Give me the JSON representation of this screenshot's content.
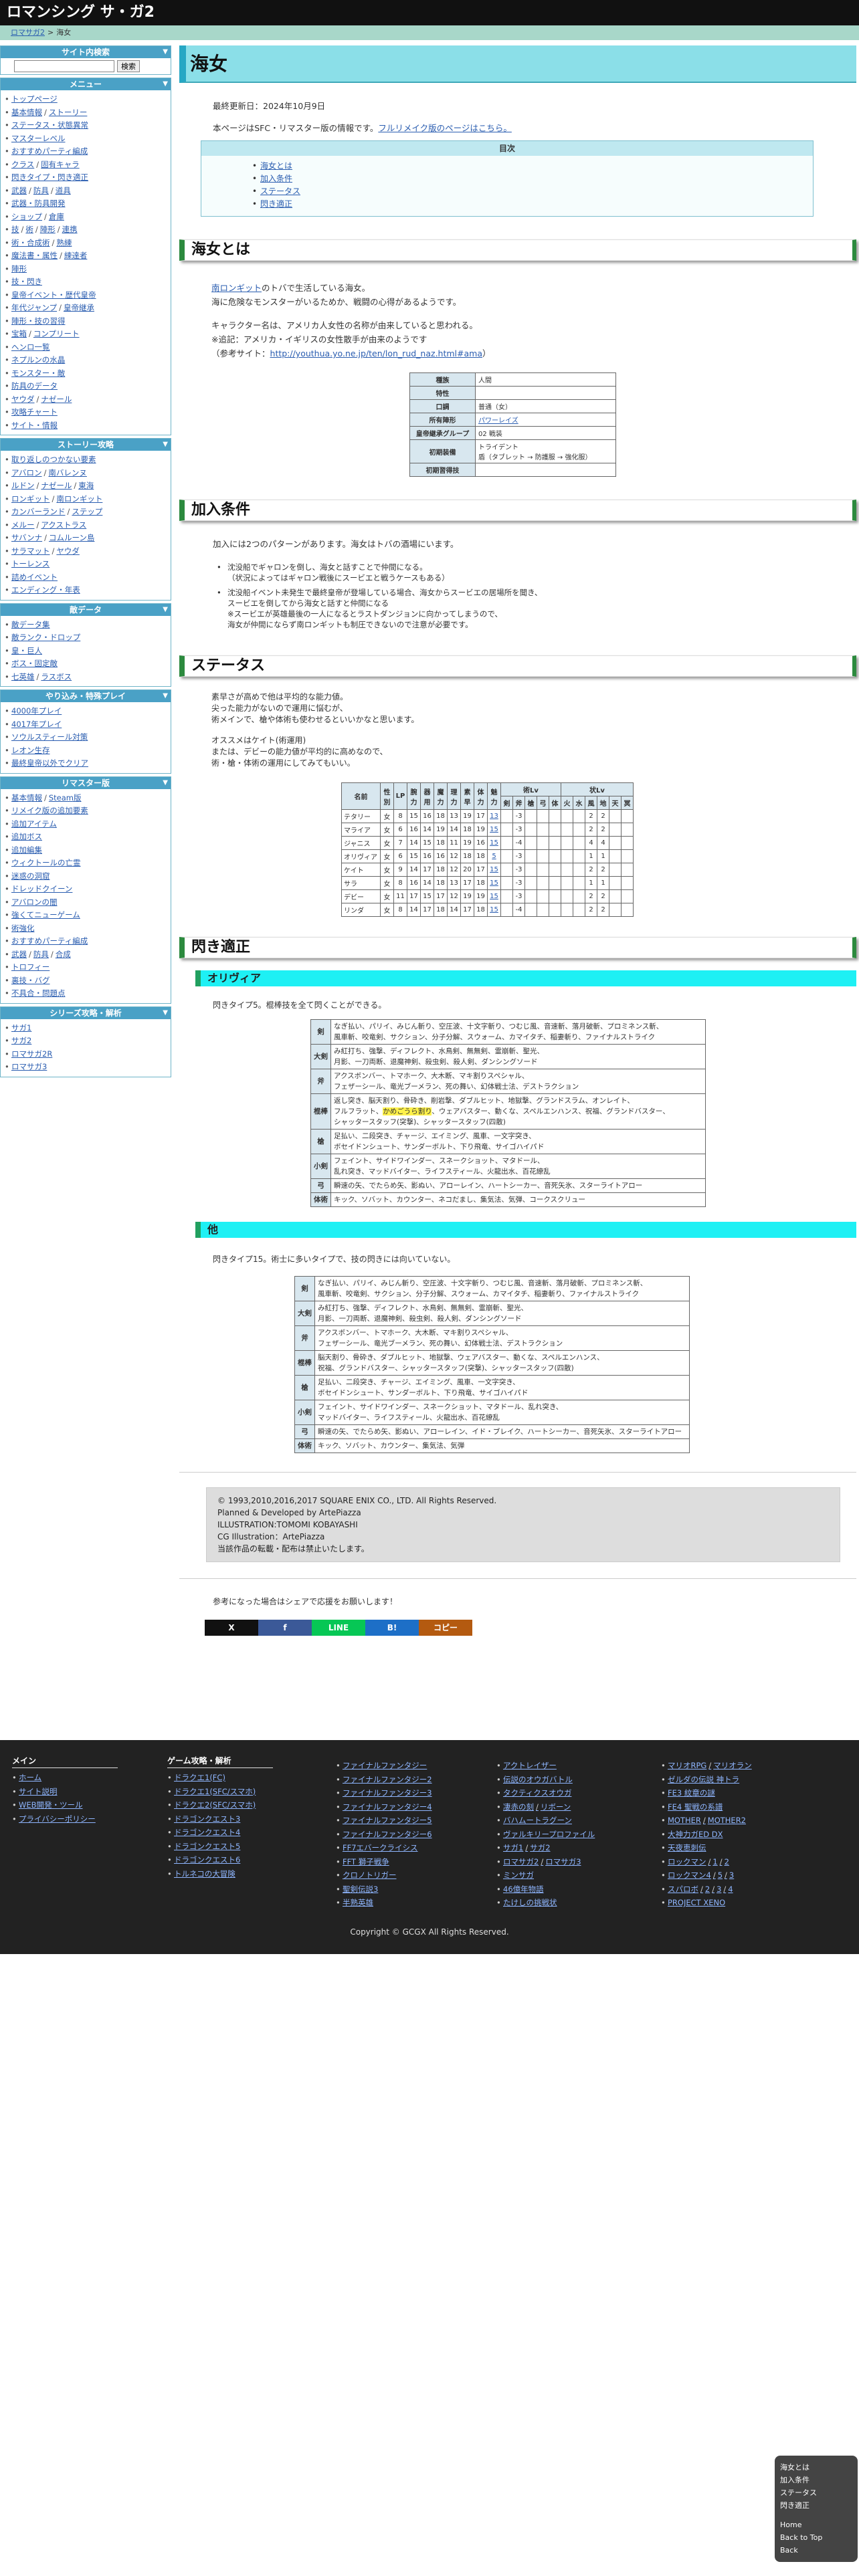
{
  "site_title": "ロマンシング サ・ガ2",
  "breadcrumb": {
    "home": "ロマサガ2",
    "sep": ">",
    "current": "海女"
  },
  "sidebar": {
    "search": {
      "title": "サイト内検索",
      "button": "検索"
    },
    "menu": {
      "title": "メニュー",
      "items": [
        [
          "トップページ"
        ],
        [
          "基本情報",
          "ストーリー"
        ],
        [
          "ステータス・状態異常"
        ],
        [
          "マスターレベル"
        ],
        [
          "おすすめパーティ編成"
        ],
        [
          "クラス",
          "固有キャラ"
        ],
        [
          "閃きタイプ・閃き適正"
        ],
        [
          "武器",
          "防具",
          "道具"
        ],
        [
          "武器・防具開発"
        ],
        [
          "ショップ",
          "倉庫"
        ],
        [
          "技",
          "術",
          "陣形",
          "連携"
        ],
        [
          "術・合成術",
          "熟練"
        ],
        [
          "魔法書・属性",
          "練達者"
        ],
        [
          "陣形"
        ],
        [
          "技・閃き"
        ],
        [
          "皇帝イベント・歴代皇帝"
        ],
        [
          "年代ジャンプ",
          "皇帝継承"
        ],
        [
          "陣形・技の習得"
        ],
        [
          "宝箱",
          "コンプリート"
        ],
        [
          "ヘンロ一覧"
        ],
        [
          "ネプルンの水晶"
        ],
        [
          "モンスター・敵"
        ],
        [
          "防具のデータ"
        ],
        [
          "ヤウダ",
          "ナゼール"
        ],
        [
          "攻略チャート"
        ],
        [
          "サイト・情報"
        ]
      ]
    },
    "story": {
      "title": "ストーリー攻略",
      "items": [
        [
          "取り返しのつかない要素"
        ],
        [
          "アバロン",
          "南バレンヌ"
        ],
        [
          "ルドン",
          "ナゼール",
          "東海"
        ],
        [
          "ロンギット",
          "南ロンギット"
        ],
        [
          "カンバーランド",
          "ステップ"
        ],
        [
          "メルー",
          "アクストラス"
        ],
        [
          "サバンナ",
          "コムルーン島"
        ],
        [
          "サラマット",
          "ヤウダ"
        ],
        [
          "トーレンス"
        ],
        [
          "詰めイベント"
        ],
        [
          "エンディング・年表"
        ]
      ]
    },
    "db": {
      "title": "敵データ",
      "items": [
        [
          "敵データ集"
        ],
        [
          "敵ランク・ドロップ"
        ],
        [
          "皇・巨人"
        ],
        [
          "ボス・固定敵"
        ],
        [
          "七英雄",
          "ラスボス"
        ]
      ]
    },
    "play": {
      "title": "やり込み・特殊プレイ",
      "items": [
        [
          "4000年プレイ"
        ],
        [
          "4017年プレイ"
        ],
        [
          "ソウルスティール対策"
        ],
        [
          "レオン生存"
        ],
        [
          "最終皇帝以外でクリア"
        ]
      ]
    },
    "remaster": {
      "title": "リマスター版",
      "items": [
        [
          "基本情報",
          "Steam版"
        ],
        [
          "リメイク版の追加要素"
        ],
        [
          "追加アイテム"
        ],
        [
          "追加ボス"
        ],
        [
          "追加編集"
        ],
        [
          "ウィクトールの亡霊"
        ],
        [
          "迷惑の洞窟"
        ],
        [
          "ドレッドクイーン"
        ],
        [
          "アバロンの闇"
        ],
        [
          "強くてニューゲーム"
        ],
        [
          "術強化"
        ],
        [
          "おすすめパーティ編成"
        ],
        [
          "武器",
          "防具",
          "合成"
        ],
        [
          "トロフィー"
        ],
        [
          "裏技・バグ"
        ],
        [
          "不具合・問題点"
        ]
      ]
    },
    "series": {
      "title": "シリーズ攻略・解析",
      "items": [
        [
          "サガ1"
        ],
        [
          "サガ2"
        ],
        [
          "ロマサガ2R"
        ],
        [
          "ロマサガ3"
        ]
      ]
    }
  },
  "page": {
    "title": "海女",
    "updated": "最終更新日：2024年10月9日",
    "intro_text": "本ページはSFC・リマスター版の情報です。",
    "intro_link": "フルリメイク版のページはこちら。",
    "toc": {
      "title": "目次",
      "items": [
        "海女とは",
        "加入条件",
        "ステータス",
        "閃き適正"
      ]
    },
    "s1": {
      "heading": "海女とは",
      "l1_link": "南ロンギット",
      "l1": "のトバで生活している海女。",
      "l2": "海に危険なモンスターがいるためか、戦闘の心得があるようです。",
      "l3": "キャラクター名は、アメリカ人女性の名称が由来していると思われる。",
      "l4": "※追記：アメリカ・イギリスの女性散手が由来のようです",
      "l5": "（参考サイト：",
      "l5_link": "http://youthua.yo.ne.jp/ten/lon_rud_naz.html#ama",
      "l5_end": "）",
      "attr": [
        [
          "種族",
          "人間"
        ],
        [
          "特性",
          ""
        ],
        [
          "口調",
          "普通（女）"
        ],
        [
          "所有陣形",
          "パワーレイズ"
        ],
        [
          "皇帝継承グループ",
          "02 戦装"
        ],
        [
          "初期装備",
          "トライデント\n盾（タブレット → 防護服 → 強化服）"
        ],
        [
          "初期習得技",
          ""
        ]
      ]
    },
    "s2": {
      "heading": "加入条件",
      "l1": "加入には2つのパターンがあります。海女はトバの酒場にいます。",
      "b1a": "沈没船でギャロンを倒し、海女と話すことで仲間になる。",
      "b1b": "（状況によってはギャロン戦後にスービエと戦うケースもある）",
      "b2a": "沈没船イベント未発生で最終皇帝が登場している場合、海女からスービエの居場所を聞き、",
      "b2b": "スービエを倒してから海女と話すと仲間になる",
      "b2c": "※スービエが英雄最後の一人になるとラストダンジョンに向かってしまうので、",
      "b2d": "海女が仲間にならず南ロンギットも制圧できないので注意が必要です。"
    },
    "s3": {
      "heading": "ステータス",
      "l1": "素早さが高めで他は平均的な能力値。",
      "l2": "尖った能力がないので運用に悩むが、",
      "l3": "術メインで、槍や体術も使わせるといいかなと思います。",
      "l4": "オススメはケイト(術運用)",
      "l5": "または、デビーの能力値が平均的に高めなので、",
      "l6": "術・槍・体術の運用にしてみてもいい。",
      "head1": [
        "名前",
        "性別",
        "LP",
        "腕力",
        "器用",
        "魔力",
        "理力",
        "素早",
        "体力",
        "魅力",
        "術Lv",
        "状Lv"
      ],
      "jlv": [
        "剣",
        "斧",
        "槍",
        "弓",
        "体"
      ],
      "slv": [
        "火",
        "水",
        "風",
        "地",
        "天",
        "冥"
      ],
      "rows": [
        [
          "テタリー",
          "女",
          "8",
          "15",
          "16",
          "18",
          "13",
          "19",
          "17",
          "13",
          "-3",
          "",
          "2",
          "2"
        ],
        [
          "マライア",
          "女",
          "6",
          "16",
          "14",
          "19",
          "14",
          "18",
          "19",
          "15",
          "-3",
          "",
          "2",
          "2"
        ],
        [
          "ジャニス",
          "女",
          "7",
          "14",
          "15",
          "18",
          "11",
          "19",
          "16",
          "15",
          "-4",
          "",
          "4",
          "4"
        ],
        [
          "オリヴィア",
          "女",
          "6",
          "15",
          "16",
          "16",
          "12",
          "18",
          "18",
          "5",
          "-3",
          "",
          "1",
          "1"
        ],
        [
          "ケイト",
          "女",
          "9",
          "14",
          "17",
          "18",
          "12",
          "20",
          "17",
          "15",
          "-3",
          "",
          "2",
          "2"
        ],
        [
          "サラ",
          "女",
          "8",
          "16",
          "14",
          "18",
          "13",
          "17",
          "18",
          "15",
          "-3",
          "",
          "1",
          "1"
        ],
        [
          "デビー",
          "女",
          "11",
          "17",
          "15",
          "17",
          "12",
          "19",
          "19",
          "15",
          "-3",
          "",
          "2",
          "2"
        ],
        [
          "リンダ",
          "女",
          "8",
          "14",
          "17",
          "18",
          "14",
          "17",
          "18",
          "15",
          "-4",
          "",
          "2",
          "2"
        ]
      ]
    },
    "s4": {
      "heading": "閃き適正",
      "sub1": "オリヴィア",
      "sub1_text": "閃きタイプ5。棍棒技を全て閃くことができる。",
      "t1": [
        [
          "剣",
          "なぎ払い、パリイ、みじん斬り、空圧波、十文字斬り、つむじ風、音速斬、落月破斬、プロミネンス斬、\n風車斬、咬竜剣、サクション、分子分解、スウォーム、カマイタチ、稲妻斬り、ファイナルストライク",
          ""
        ],
        [
          "大剣",
          "み紅打ち、強撃、ディフレクト、水鳥剣、無無剣、霊崩斬、聖光、\n月影、一刀両断、退魔神剣、殺虫剣、殺人剣、ダンシングソード",
          ""
        ],
        [
          "斧",
          "アクスボンバー、トマホーク、大木断、マキ割りスペシャル、\nフェザーシール、竜光ブーメラン、死の舞い、幻体戦士法、デストラクション",
          ""
        ],
        [
          "棍棒",
          "返し突き、脳天割り、骨砕き、削岩撃、ダブルヒット、地獄撃、グランドスラム、オンレイト、\nフルフラット、",
          "かめごうら割り",
          "、ウェアバスター、動くな、スペルエンハンス、祝福、グランドバスター、\nシャッタースタッフ(突撃)、シャッタースタッフ(四散)"
        ],
        [
          "槍",
          "足払い、二段突き、チャージ、エイミング、風車、一文字突き、\nボセイドンシュート、サンダーボルト、下り飛竜、サイゴハイパド",
          ""
        ],
        [
          "小剣",
          "フェイント、サイドワインダー、スネークショット、マタドール、\n乱れ突き、マッドバイター、ライフスティール、火龍出水、百花繚乱",
          ""
        ],
        [
          "弓",
          "瞬速の矢、でたらめ矢、影ぬい、アローレイン、ハートシーカー、音死矢氷、スターライトアロー",
          ""
        ],
        [
          "体術",
          "キック、ソバット、カウンター、ネコだまし、集気法、気弾、コークスクリュー",
          ""
        ]
      ],
      "sub2": "他",
      "sub2_text": "閃きタイプ15。術士に多いタイプで、技の閃きには向いていない。",
      "t2": [
        [
          "剣",
          "なぎ払い、パリイ、みじん斬り、空圧波、十文字斬り、つむじ風、音速斬、落月破斬、プロミネンス斬、\n風車斬、咬竜剣、サクション、分子分解、スウォーム、カマイタチ、稲妻斬り、ファイナルストライク"
        ],
        [
          "大剣",
          "み紅打ち、強撃、ディフレクト、水鳥剣、無無剣、霊崩斬、聖光、\n月影、一刀両断、退魔神剣、殺虫剣、殺人剣、ダンシングソード"
        ],
        [
          "斧",
          "アクスボンバー、トマホーク、大木断、マキ割りスペシャル、\nフェザーシール、竜光ブーメラン、死の舞い、幻体戦士法、デストラクション"
        ],
        [
          "棍棒",
          "脳天割り、骨砕き、ダブルヒット、地獄撃、ウェアバスター、動くな、スペルエンハンス、\n祝福、グランドバスター、シャッタースタッフ(突撃)、シャッタースタッフ(四散)"
        ],
        [
          "槍",
          "足払い、二段突き、チャージ、エイミング、風車、一文字突き、\nボセイドンシュート、サンダーボルト、下り飛竜、サイゴハイパド"
        ],
        [
          "小剣",
          "フェイント、サイドワインダー、スネークショット、マタドール、乱れ突き、\nマッドバイター、ライフスティール、火龍出水、百花繚乱"
        ],
        [
          "弓",
          "瞬速の矢、でたらめ矢、影ぬい、アローレイン、イド・ブレイク、ハートシーカー、音死矢氷、スターライトアロー"
        ],
        [
          "体術",
          "キック、ソバット、カウンター、集気法、気弾"
        ]
      ]
    },
    "copyright": [
      "© 1993,2010,2016,2017 SQUARE ENIX CO., LTD. All Rights Reserved.",
      "Planned & Developed by ArtePiazza",
      "ILLUSTRATION:TOMOMI KOBAYASHI",
      "CG Illustration：ArtePiazza",
      "当該作品の転載・配布は禁止いたします。"
    ],
    "share_text": "参考になった場合はシェアで応援をお願いします！",
    "share": [
      {
        "label": "X",
        "color": "#111111"
      },
      {
        "label": "f",
        "color": "#3b5998"
      },
      {
        "label": "LINE",
        "color": "#06c755"
      },
      {
        "label": "B!",
        "color": "#1d6fc7"
      },
      {
        "label": "コピー",
        "color": "#b45a10"
      }
    ]
  },
  "footer": {
    "cols": [
      {
        "title": "メイン",
        "items": [
          [
            "ホーム"
          ],
          [
            "サイト説明"
          ],
          [
            "WEB開発・ツール"
          ],
          [
            "プライバシーポリシー"
          ]
        ]
      },
      {
        "title": "ゲーム攻略・解析",
        "items": [
          [
            "ドラクエ1(FC)"
          ],
          [
            "ドラクエ1(SFC/スマホ)"
          ],
          [
            "ドラクエ2(SFC/スマホ)"
          ],
          [
            "ドラゴンクエスト3"
          ],
          [
            "ドラゴンクエスト4"
          ],
          [
            "ドラゴンクエスト5"
          ],
          [
            "ドラゴンクエスト6"
          ],
          [
            "トルネコの大冒険"
          ]
        ]
      },
      {
        "title": "",
        "items": [
          [
            "ファイナルファンタジー"
          ],
          [
            "ファイナルファンタジー2"
          ],
          [
            "ファイナルファンタジー3"
          ],
          [
            "ファイナルファンタジー4"
          ],
          [
            "ファイナルファンタジー5"
          ],
          [
            "ファイナルファンタジー6"
          ],
          [
            "FF7エバークライシス"
          ],
          [
            "FFT 獅子戦争"
          ],
          [
            "クロノトリガー"
          ],
          [
            "聖剣伝説3"
          ],
          [
            "半熟英雄"
          ]
        ]
      },
      {
        "title": "",
        "items": [
          [
            "アクトレイザー"
          ],
          [
            "伝説のオウガバトル"
          ],
          [
            "タクティクスオウガ"
          ],
          [
            "凄赤の刻",
            "リボーン"
          ],
          [
            "バハムートラグーン"
          ],
          [
            "ヴァルキリープロファイル"
          ],
          [
            "サガ1",
            "サガ2"
          ],
          [
            "ロマサガ2",
            "ロマサガ3"
          ],
          [
            "ミンサガ"
          ],
          [
            "46億年物語"
          ],
          [
            "たけしの挑戦状"
          ]
        ]
      },
      {
        "title": "",
        "items": [
          [
            "マリオRPG",
            "マリオラン"
          ],
          [
            "ゼルダの伝説 神トラ"
          ],
          [
            "FE3 紋章の謎"
          ],
          [
            "FE4 聖戦の系譜"
          ],
          [
            "MOTHER",
            "MOTHER2"
          ],
          [
            "大神力ガED DX"
          ],
          [
            "天夜恵刺伝"
          ],
          [
            "ロックマン",
            "1",
            "2"
          ],
          [
            "ロックマン4",
            "5",
            "3"
          ],
          [
            "スパロボ",
            "2",
            "3",
            "4"
          ],
          [
            "PROJECT XENO"
          ]
        ]
      }
    ],
    "copyright": "Copyright © GCGX All Rights Reserved."
  },
  "float_nav": {
    "items": [
      "海女とは",
      "加入条件",
      "ステータス",
      "閃き適正"
    ],
    "bottom": [
      "Home",
      "Back to Top",
      "Back"
    ]
  }
}
